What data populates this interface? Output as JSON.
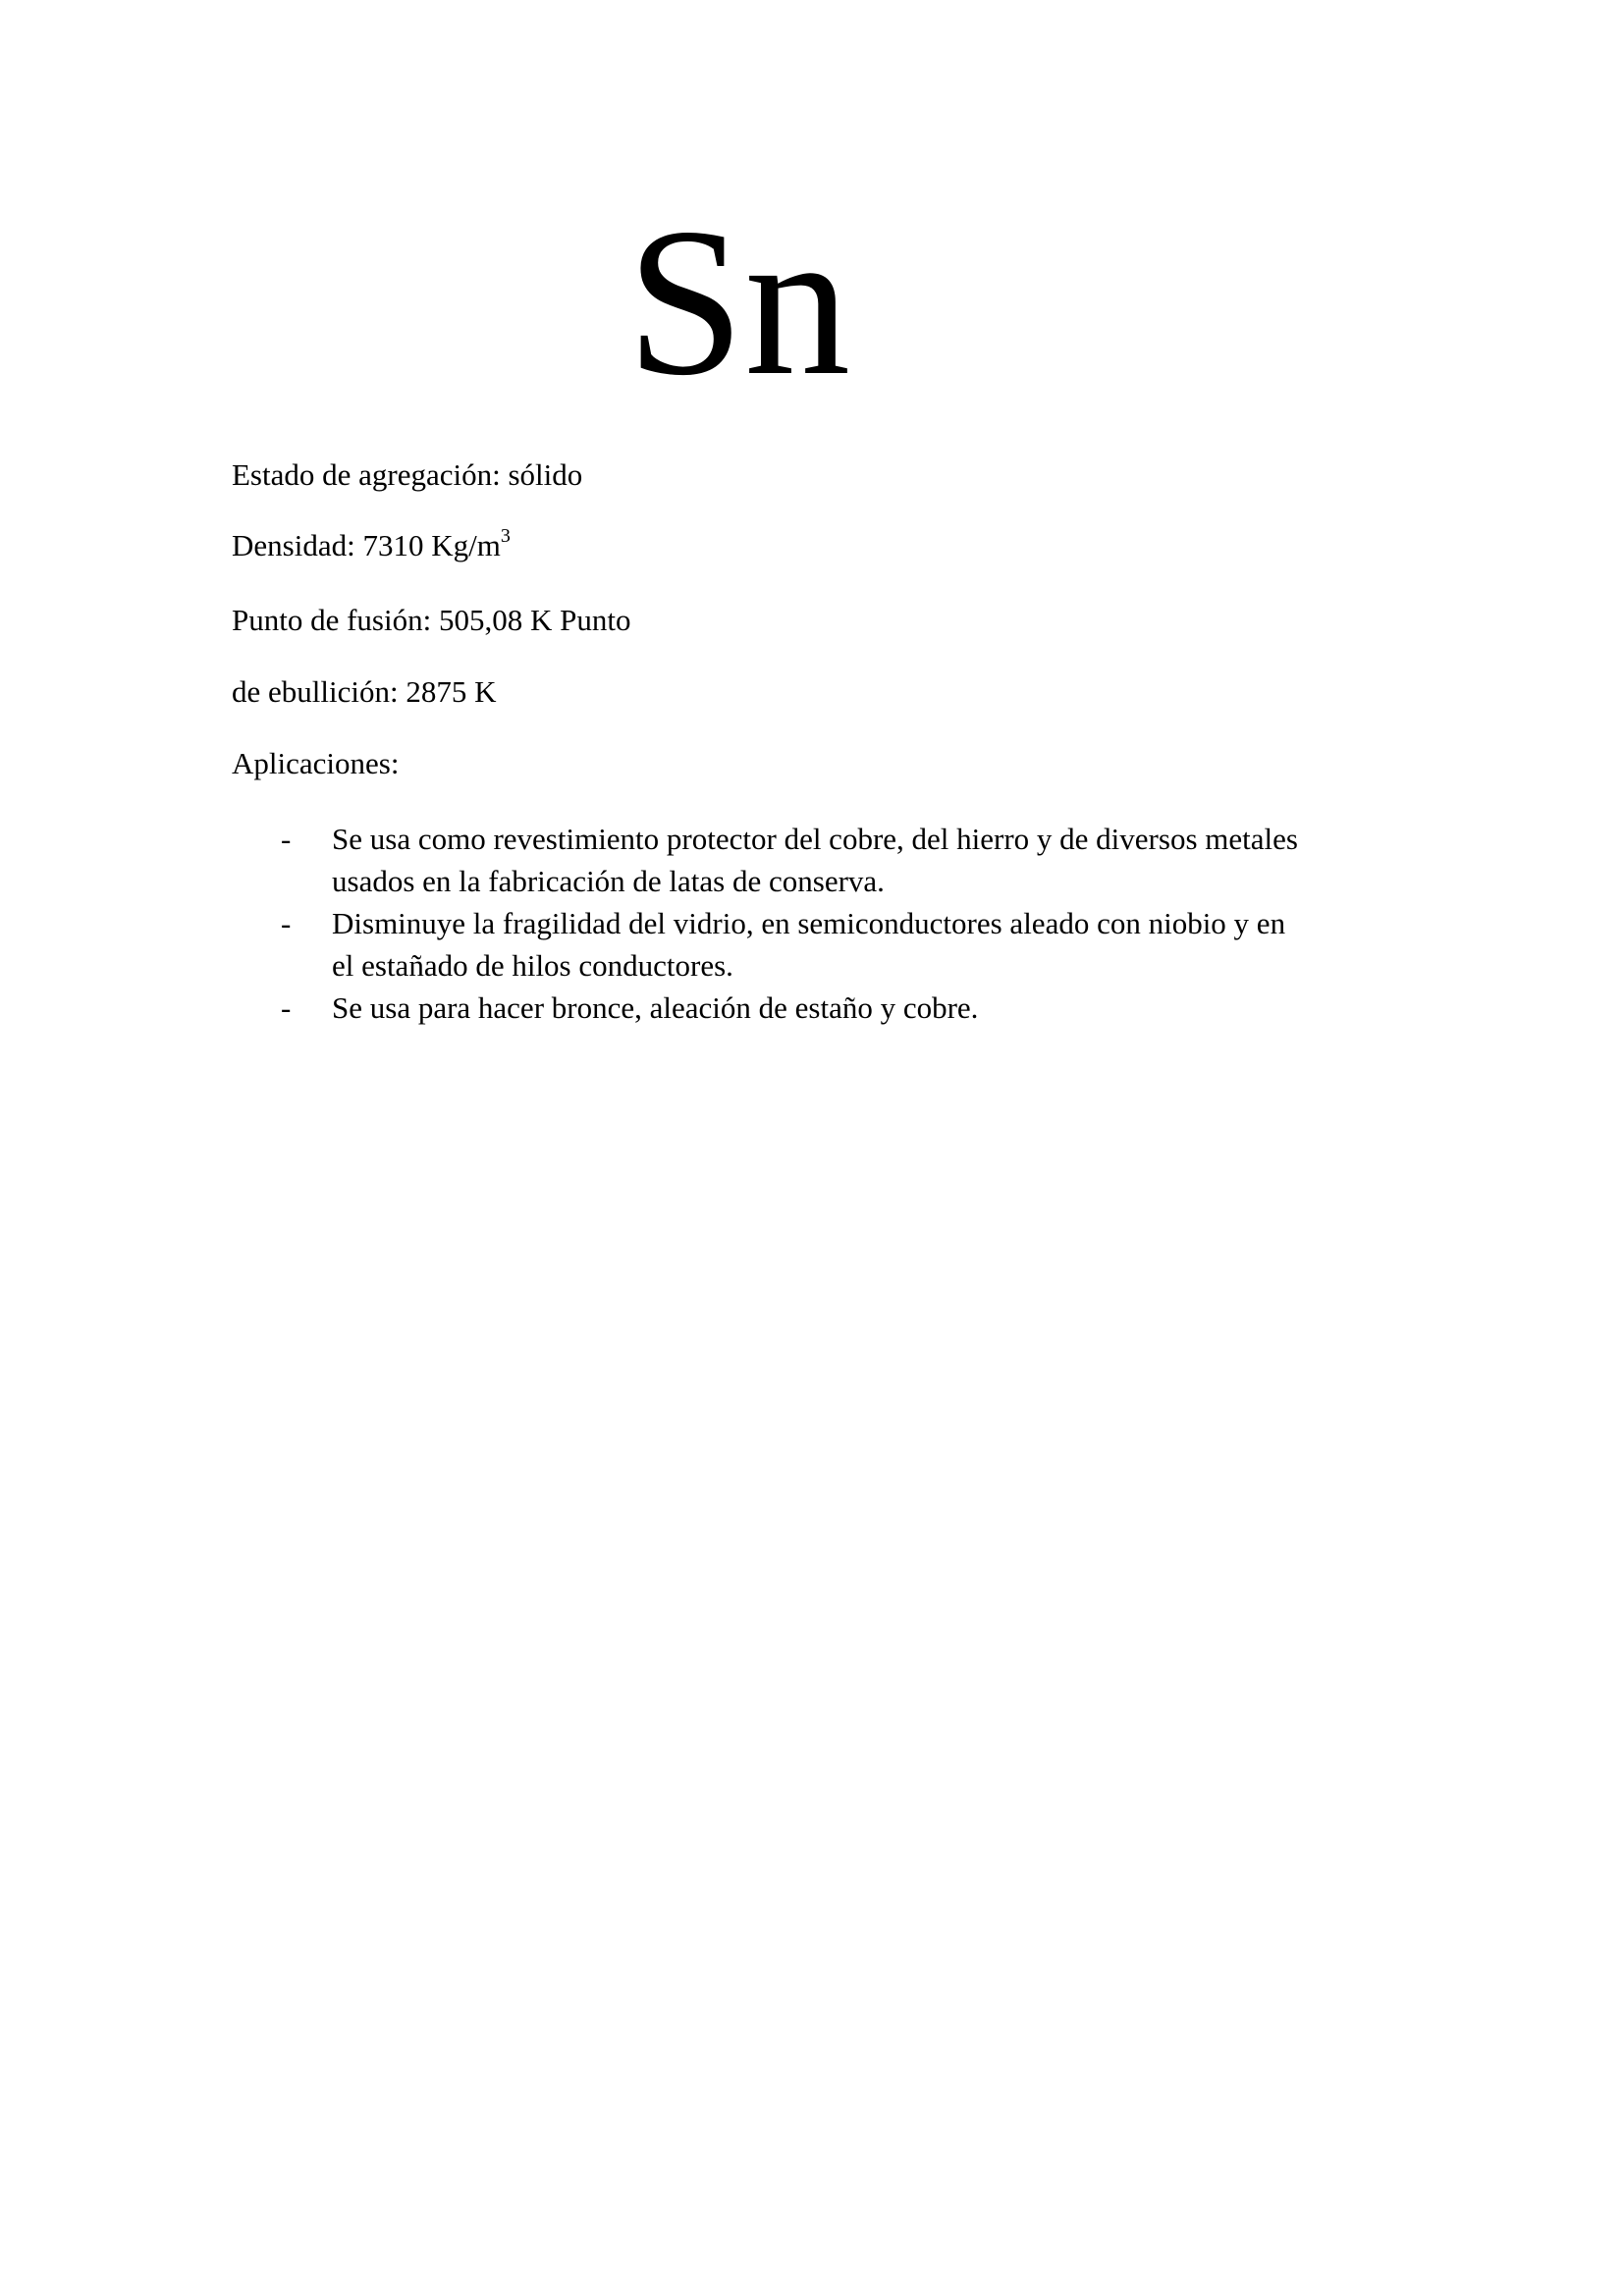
{
  "element": {
    "symbol": "Sn"
  },
  "properties": {
    "estado": "Estado de agregación: sólido",
    "densidad_text": "Densidad: 7310 Kg/m",
    "densidad_sup": "3",
    "fusion": "Punto de fusión: 505,08 K Punto",
    "ebullicion": "de ebullición: 2875 K",
    "aplicaciones_label": "Aplicaciones:"
  },
  "aplicaciones": {
    "bullet": "-",
    "items": [
      "Se usa como revestimiento protector del cobre, del hierro y de diversos metales usados en la fabricación de latas de conserva.",
      "Disminuye la fragilidad del vidrio, en semiconductores aleado con niobio y en el estañado de hilos conductores.",
      "Se usa para hacer bronce, aleación de estaño y cobre."
    ]
  }
}
